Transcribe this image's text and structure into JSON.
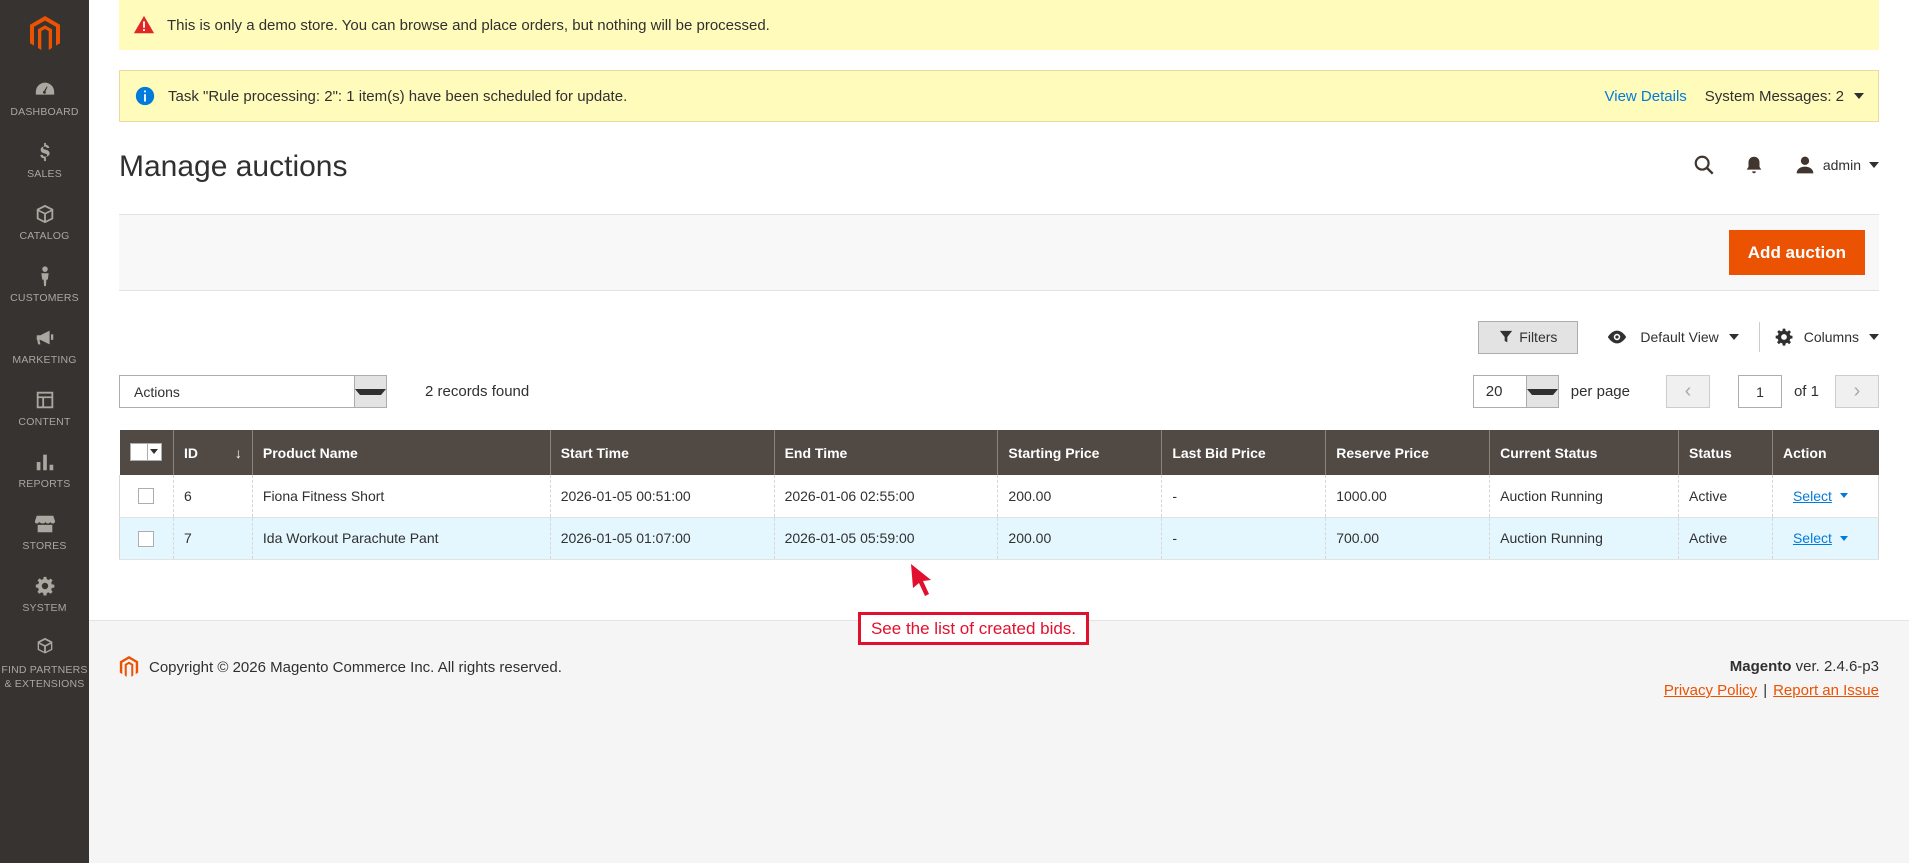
{
  "sidebar": {
    "items": [
      {
        "label": "DASHBOARD",
        "icon": "dashboard-icon"
      },
      {
        "label": "SALES",
        "icon": "dollar-icon"
      },
      {
        "label": "CATALOG",
        "icon": "cube-icon"
      },
      {
        "label": "CUSTOMERS",
        "icon": "person-icon"
      },
      {
        "label": "MARKETING",
        "icon": "megaphone-icon"
      },
      {
        "label": "CONTENT",
        "icon": "layout-icon"
      },
      {
        "label": "REPORTS",
        "icon": "bar-chart-icon"
      },
      {
        "label": "STORES",
        "icon": "storefront-icon"
      },
      {
        "label": "SYSTEM",
        "icon": "gear-icon"
      },
      {
        "label_line1": "FIND PARTNERS",
        "label_line2": "& EXTENSIONS",
        "icon": "boxes-icon"
      }
    ]
  },
  "messages": {
    "demo": "This is only a demo store. You can browse and place orders, but nothing will be processed.",
    "task": "Task \"Rule processing: 2\": 1 item(s) have been scheduled for update.",
    "view_details": "View Details",
    "system_messages": "System Messages: 2"
  },
  "header": {
    "title": "Manage auctions",
    "user": "admin"
  },
  "action_bar": {
    "add_button": "Add auction"
  },
  "toolbar": {
    "filters": "Filters",
    "view": "Default View",
    "columns": "Columns",
    "actions": "Actions",
    "records": "2 records found",
    "per_page_value": "20",
    "per_page_label": "per page",
    "page": "1",
    "of": "of 1"
  },
  "grid": {
    "headers": {
      "id": "ID",
      "sort": "↓",
      "product": "Product Name",
      "start": "Start Time",
      "end": "End Time",
      "starting_price": "Starting Price",
      "last_bid": "Last Bid Price",
      "reserve": "Reserve Price",
      "current_status": "Current Status",
      "status": "Status",
      "action": "Action"
    },
    "rows": [
      {
        "id": "6",
        "product": "Fiona Fitness Short",
        "start": "2026-01-05 00:51:00",
        "end": "2026-01-06 02:55:00",
        "starting_price": "200.00",
        "last_bid": "-",
        "reserve": "1000.00",
        "current_status": "Auction Running",
        "status": "Active",
        "action": "Select"
      },
      {
        "id": "7",
        "product": "Ida Workout Parachute Pant",
        "start": "2026-01-05 01:07:00",
        "end": "2026-01-05 05:59:00",
        "starting_price": "200.00",
        "last_bid": "-",
        "reserve": "700.00",
        "current_status": "Auction Running",
        "status": "Active",
        "action": "Select"
      }
    ]
  },
  "annotation": {
    "text": "See the list of created bids."
  },
  "footer": {
    "copyright": "Copyright © 2026 Magento Commerce Inc. All rights reserved.",
    "brand": "Magento",
    "version": " ver. 2.4.6-p3",
    "privacy": "Privacy Policy",
    "separator": "|",
    "report": "Report an Issue"
  },
  "colors": {
    "sidebar": "#373330",
    "accent": "#eb5202",
    "grid_header": "#514943",
    "notice_bg": "#fffbbb",
    "link": "#007bdb",
    "annotation": "#e0102e"
  }
}
